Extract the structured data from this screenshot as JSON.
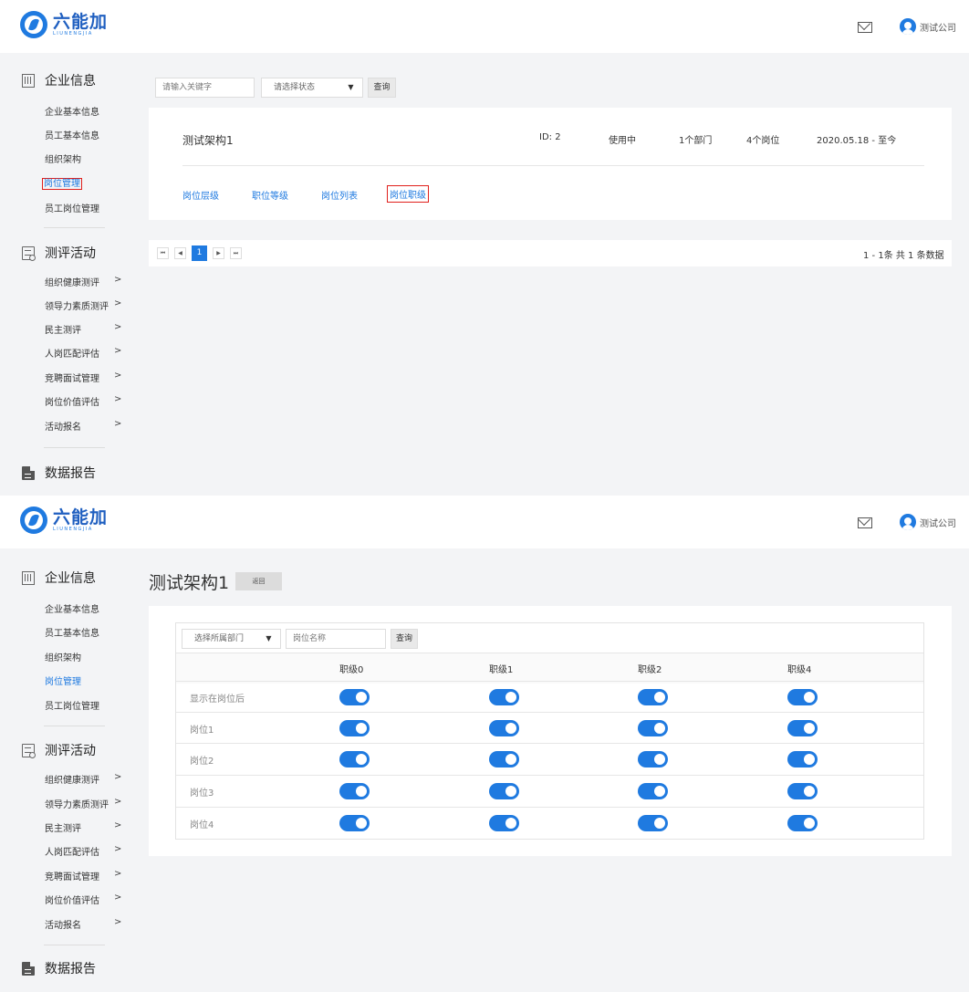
{
  "header": {
    "logo_cn": "六能加",
    "logo_en": "LIUNENGJIA",
    "user_name": "测试公司"
  },
  "sidebar": {
    "groups": [
      {
        "title": "企业信息",
        "icon": "building-icon",
        "items": [
          "企业基本信息",
          "员工基本信息",
          "组织架构",
          "岗位管理",
          "员工岗位管理"
        ]
      },
      {
        "title": "测评活动",
        "icon": "assessment-list-icon",
        "items": [
          "组织健康测评",
          "领导力素质测评",
          "民主测评",
          "人岗匹配评估",
          "竞聘面试管理",
          "岗位价值评估",
          "活动报名"
        ]
      },
      {
        "title": "数据报告",
        "icon": "report-doc-icon",
        "items": []
      }
    ],
    "arrow": ">",
    "active_item": "岗位管理"
  },
  "screen1": {
    "search_placeholder": "请输入关键字",
    "status_placeholder": "请选择状态",
    "caret": "▼",
    "query_label": "查询",
    "arch_name": "测试架构1",
    "arch_id": "ID:  2",
    "arch_status": "使用中",
    "dept_count": "1个部门",
    "post_count": "4个岗位",
    "date_range": "2020.05.18 - 至今",
    "links": [
      "岗位层级",
      "职位等级",
      "岗位列表",
      "岗位职级"
    ],
    "pager": {
      "first": "⏮",
      "prev": "◀",
      "current": "1",
      "next": "▶",
      "last": "⏭",
      "info": "1 - 1条  共 1 条数据"
    }
  },
  "screen2": {
    "title": "测试架构1",
    "back_label": "返回",
    "dept_placeholder": "选择所属部门",
    "caret": "▼",
    "post_placeholder": "岗位名称",
    "query_label": "查询",
    "columns": [
      "职级0",
      "职级1",
      "职级2",
      "职级4"
    ],
    "rows": [
      {
        "label": "显示在岗位后",
        "toggles": [
          true,
          true,
          true,
          true
        ]
      },
      {
        "label": "岗位1",
        "toggles": [
          true,
          true,
          true,
          true
        ]
      },
      {
        "label": "岗位2",
        "toggles": [
          true,
          true,
          true,
          true
        ]
      },
      {
        "label": "岗位3",
        "toggles": [
          true,
          true,
          true,
          true
        ]
      },
      {
        "label": "岗位4",
        "toggles": [
          true,
          true,
          true,
          true
        ]
      }
    ]
  },
  "colors": {
    "accent": "#1f7ae0",
    "highlight_border": "#e0201c",
    "background": "#f3f4f6"
  }
}
